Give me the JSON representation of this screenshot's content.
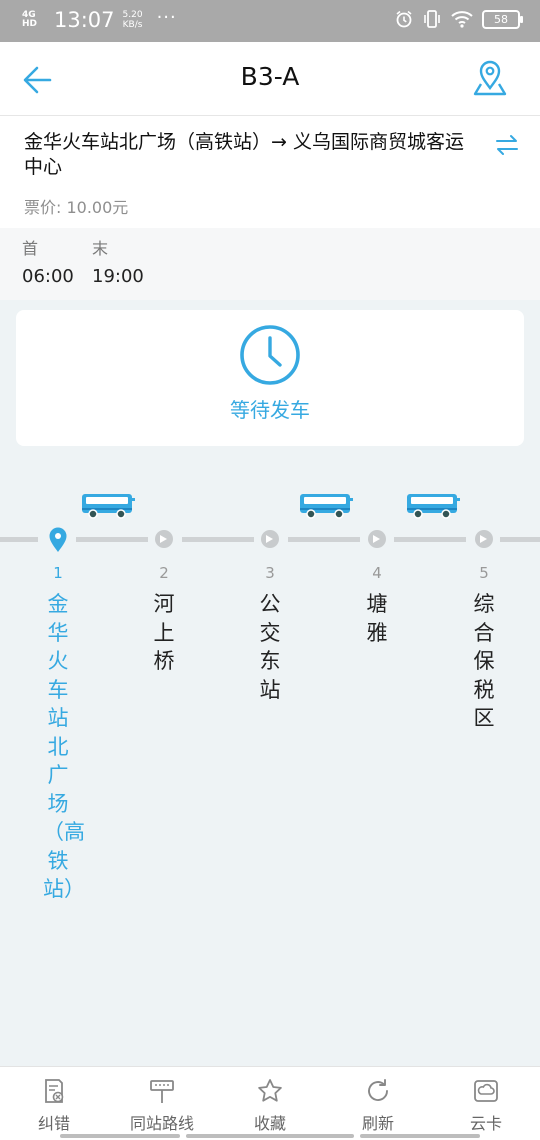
{
  "status_bar": {
    "network": "4G HD",
    "time": "13:07",
    "speed_value": "5.20",
    "speed_unit": "KB/s",
    "more": "···",
    "battery": "58"
  },
  "header": {
    "title": "B3-A",
    "back_icon": "arrow-left-icon",
    "map_icon": "map-pin-icon"
  },
  "route": {
    "stops_text": "金华火车站北广场（高铁站）→ 义乌国际商贸城客运中心",
    "fare": "票价: 10.00元"
  },
  "schedule": {
    "first_label": "首",
    "last_label": "末",
    "first_time": "06:00",
    "last_time": "19:00"
  },
  "waiting": {
    "text": "等待发车"
  },
  "stations": [
    {
      "num": "1",
      "name": "金华火车站北广场（高铁站）"
    },
    {
      "num": "2",
      "name": "河上桥"
    },
    {
      "num": "3",
      "name": "公交东站"
    },
    {
      "num": "4",
      "name": "塘雅"
    },
    {
      "num": "5",
      "name": "综合保税区"
    }
  ],
  "nav": [
    {
      "label": "纠错",
      "icon": "error-report-icon"
    },
    {
      "label": "同站路线",
      "icon": "bus-stop-icon"
    },
    {
      "label": "收藏",
      "icon": "star-icon"
    },
    {
      "label": "刷新",
      "icon": "refresh-icon"
    },
    {
      "label": "云卡",
      "icon": "cloud-card-icon"
    }
  ],
  "colors": {
    "accent": "#36a9e1",
    "line": "#cfd2d4",
    "background": "#eef3f5"
  }
}
